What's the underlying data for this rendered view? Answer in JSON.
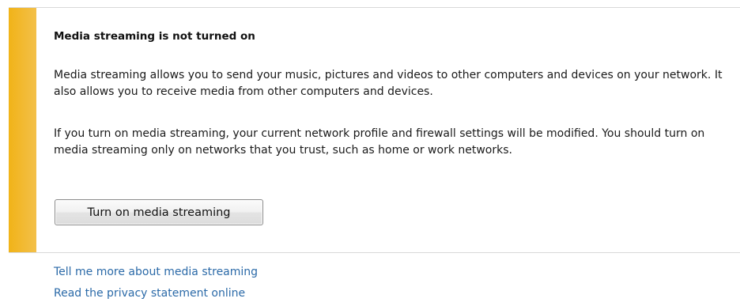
{
  "panel": {
    "title": "Media streaming is not turned on",
    "paragraphs": [
      "Media streaming allows you to send your music, pictures and videos to other computers and devices on your network.  It also allows you to receive media from other computers and devices.",
      "If you turn on media streaming, your current network profile and firewall settings will be modified. You should turn on media streaming only on networks that you trust, such as home or work networks."
    ],
    "button_label": "Turn on media streaming",
    "accent_color": "#f1b318"
  },
  "links": [
    {
      "label": "Tell me more about media streaming"
    },
    {
      "label": "Read the privacy statement online"
    }
  ],
  "colors": {
    "link": "#2b6aa8",
    "text": "#1a1a1a"
  }
}
